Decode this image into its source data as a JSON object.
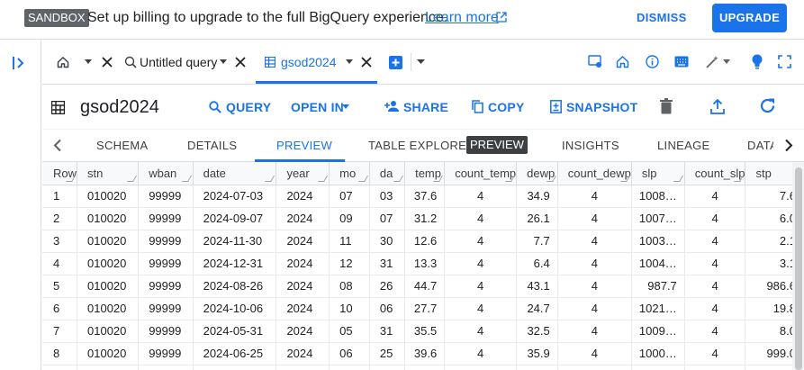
{
  "banner": {
    "badge": "SANDBOX",
    "message": "Set up billing to upgrade to the full BigQuery experience.",
    "learn_more": "Learn more",
    "dismiss": "DISMISS",
    "upgrade": "UPGRADE"
  },
  "tabs": [
    {
      "label": "",
      "icon": "home-icon"
    },
    {
      "label": "Untitled query",
      "icon": "query-icon"
    },
    {
      "label": "gsod2024",
      "icon": "table-icon",
      "active": true
    }
  ],
  "toolbar": {
    "title": "gsod2024",
    "query": "QUERY",
    "open_in": "OPEN IN",
    "share": "SHARE",
    "copy": "COPY",
    "snapshot": "SNAPSHOT"
  },
  "subtabs": {
    "schema": "SCHEMA",
    "details": "DETAILS",
    "preview": "PREVIEW",
    "table_explorer": "TABLE EXPLORER",
    "table_explorer_badge": "PREVIEW",
    "insights": "INSIGHTS",
    "lineage": "LINEAGE",
    "data": "DATA"
  },
  "grid": {
    "headers": [
      "Row",
      "stn",
      "wban",
      "date",
      "year",
      "mo",
      "da",
      "temp",
      "count_temp",
      "dewp",
      "count_dewp",
      "slp",
      "count_slp",
      "stp"
    ],
    "rows": [
      [
        "1",
        "010020",
        "99999",
        "2024-07-03",
        "2024",
        "07",
        "03",
        "37.6",
        "4",
        "34.9",
        "4",
        "1008…",
        "4",
        "7.6"
      ],
      [
        "2",
        "010020",
        "99999",
        "2024-09-07",
        "2024",
        "09",
        "07",
        "31.2",
        "4",
        "26.1",
        "4",
        "1007…",
        "4",
        "6.0"
      ],
      [
        "3",
        "010020",
        "99999",
        "2024-11-30",
        "2024",
        "11",
        "30",
        "12.6",
        "4",
        "7.7",
        "4",
        "1003…",
        "4",
        "2.1"
      ],
      [
        "4",
        "010020",
        "99999",
        "2024-12-31",
        "2024",
        "12",
        "31",
        "13.3",
        "4",
        "6.4",
        "4",
        "1004…",
        "4",
        "3.1"
      ],
      [
        "5",
        "010020",
        "99999",
        "2024-08-26",
        "2024",
        "08",
        "26",
        "44.7",
        "4",
        "43.1",
        "4",
        "987.7",
        "4",
        "986.6"
      ],
      [
        "6",
        "010020",
        "99999",
        "2024-10-06",
        "2024",
        "10",
        "06",
        "27.7",
        "4",
        "24.7",
        "4",
        "1021…",
        "4",
        "19.8"
      ],
      [
        "7",
        "010020",
        "99999",
        "2024-05-31",
        "2024",
        "05",
        "31",
        "35.5",
        "4",
        "32.5",
        "4",
        "1009…",
        "4",
        "8.0"
      ],
      [
        "8",
        "010020",
        "99999",
        "2024-06-25",
        "2024",
        "06",
        "25",
        "39.6",
        "4",
        "35.9",
        "4",
        "1000…",
        "4",
        "999.0"
      ],
      [
        "",
        "",
        "",
        "",
        "",
        "",
        "",
        "",
        "",
        "",
        "",
        "",
        "",
        ""
      ]
    ]
  },
  "colors": {
    "accent": "#1a73e8",
    "badge": "#5f6368"
  }
}
